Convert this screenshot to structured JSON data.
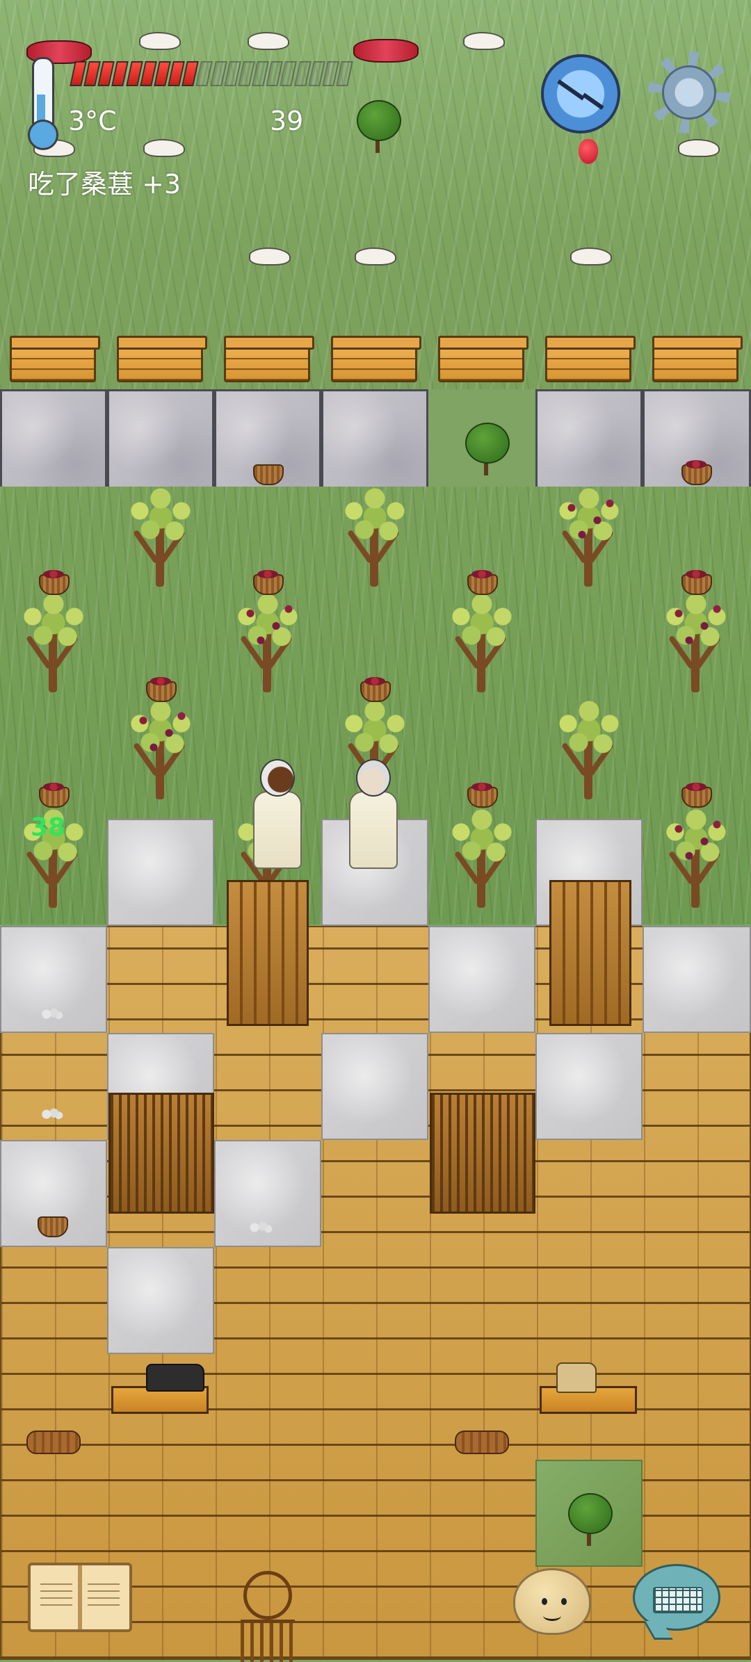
{
  "hud": {
    "temperature": "3°C",
    "food_count": "39",
    "food_pips_filled": 9,
    "food_pips_total": 20,
    "status_message": "吃了桑葚 +3",
    "age_label": "38"
  },
  "icons": {
    "thermometer": "thermometer-icon",
    "compass": "compass-icon",
    "settings": "gear-icon",
    "tech_book": "book-icon",
    "emote": "emote-face-icon",
    "keyboard": "keyboard-icon"
  },
  "colors": {
    "food_on": "#e0322a",
    "age_label": "#2ee65a",
    "hud_text": "#ffffff"
  }
}
